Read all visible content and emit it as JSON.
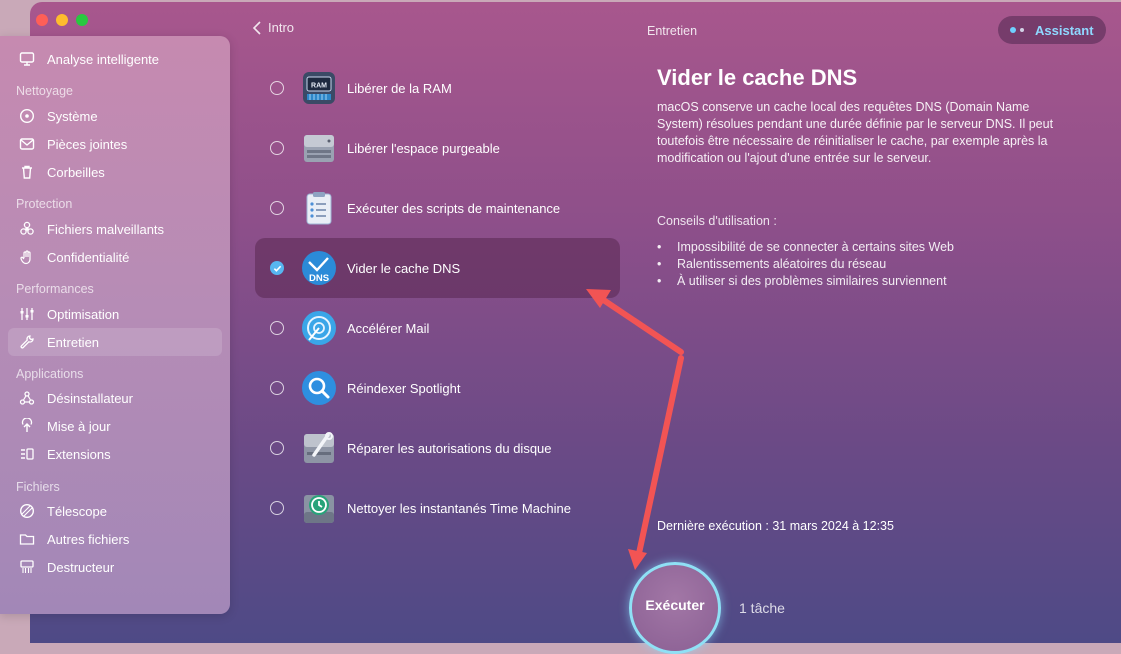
{
  "header": {
    "back_label": "Intro",
    "section_title": "Entretien",
    "assistant_label": "Assistant"
  },
  "sidebar": {
    "top_item": {
      "label": "Analyse intelligente",
      "icon": "monitor-icon"
    },
    "sections": [
      {
        "title": "Nettoyage",
        "items": [
          {
            "label": "Système",
            "icon": "disk-icon"
          },
          {
            "label": "Pièces jointes",
            "icon": "mail-icon"
          },
          {
            "label": "Corbeilles",
            "icon": "trash-icon"
          }
        ]
      },
      {
        "title": "Protection",
        "items": [
          {
            "label": "Fichiers malveillants",
            "icon": "biohazard-icon"
          },
          {
            "label": "Confidentialité",
            "icon": "hand-icon"
          }
        ]
      },
      {
        "title": "Performances",
        "items": [
          {
            "label": "Optimisation",
            "icon": "sliders-icon"
          },
          {
            "label": "Entretien",
            "icon": "wrench-icon",
            "active": true
          }
        ]
      },
      {
        "title": "Applications",
        "items": [
          {
            "label": "Désinstallateur",
            "icon": "uninstall-icon"
          },
          {
            "label": "Mise à jour",
            "icon": "update-icon"
          },
          {
            "label": "Extensions",
            "icon": "extensions-icon"
          }
        ]
      },
      {
        "title": "Fichiers",
        "items": [
          {
            "label": "Télescope",
            "icon": "lens-icon"
          },
          {
            "label": "Autres fichiers",
            "icon": "folder-icon"
          },
          {
            "label": "Destructeur",
            "icon": "shredder-icon"
          }
        ]
      }
    ]
  },
  "tasks": [
    {
      "label": "Libérer de la RAM",
      "icon": "ram-icon",
      "selected": false
    },
    {
      "label": "Libérer l'espace purgeable",
      "icon": "drive-icon",
      "selected": false
    },
    {
      "label": "Exécuter des scripts de maintenance",
      "icon": "clipboard-icon",
      "selected": false
    },
    {
      "label": "Vider le cache DNS",
      "icon": "dns-icon",
      "selected": true
    },
    {
      "label": "Accélérer Mail",
      "icon": "mail-speed-icon",
      "selected": false
    },
    {
      "label": "Réindexer Spotlight",
      "icon": "spotlight-icon",
      "selected": false
    },
    {
      "label": "Réparer les autorisations du disque",
      "icon": "disk-repair-icon",
      "selected": false
    },
    {
      "label": "Nettoyer les instantanés Time Machine",
      "icon": "time-machine-icon",
      "selected": false
    }
  ],
  "detail": {
    "title": "Vider le cache DNS",
    "description": "macOS conserve un cache local des requêtes DNS (Domain Name System) résolues pendant une durée définie par le serveur DNS. Il peut toutefois être nécessaire de réinitialiser le cache, par exemple après la modification ou l'ajout d'une entrée sur le serveur.",
    "tips_title": "Conseils d'utilisation :",
    "tips": [
      "Impossibilité de se connecter à certains sites Web",
      "Ralentissements aléatoires du réseau",
      "À utiliser si des problèmes similaires surviennent"
    ],
    "last_run": "Dernière exécution : 31 mars 2024 à 12:35",
    "dns_badge": "DNS"
  },
  "footer": {
    "run_label": "Exécuter",
    "task_count": "1 tâche"
  },
  "colors": {
    "accent_blue": "#57b6f0",
    "assistant_text": "#8fd8ff",
    "annotation_arrow": "#f25454"
  }
}
